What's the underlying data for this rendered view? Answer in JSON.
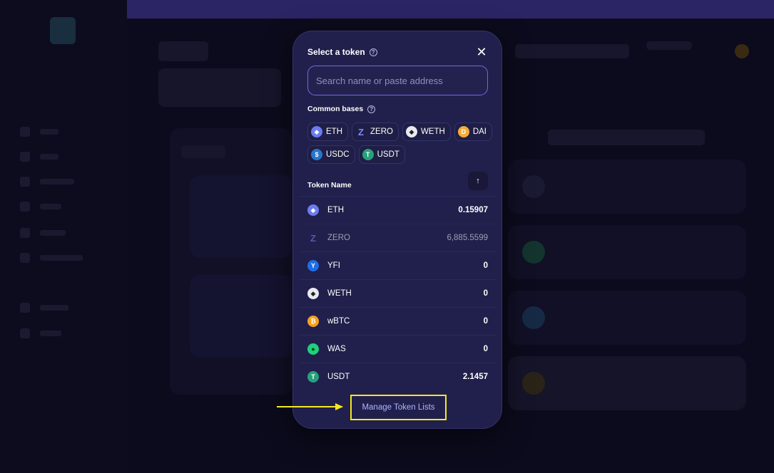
{
  "modal": {
    "title": "Select a token",
    "close_glyph": "✕",
    "help_glyph": "?",
    "search_placeholder": "Search name or paste address",
    "search_value": "",
    "common_bases_label": "Common bases",
    "common_bases": [
      {
        "symbol": "ETH",
        "icon": "eth-icon"
      },
      {
        "symbol": "ZERO",
        "icon": "zero-icon"
      },
      {
        "symbol": "WETH",
        "icon": "weth-icon"
      },
      {
        "symbol": "DAI",
        "icon": "dai-icon"
      },
      {
        "symbol": "USDC",
        "icon": "usdc-icon"
      },
      {
        "symbol": "USDT",
        "icon": "usdt-icon"
      }
    ],
    "token_name_header": "Token Name",
    "sort_glyph": "↑",
    "tokens": [
      {
        "symbol": "ETH",
        "balance": "0.15907",
        "icon": "eth-icon"
      },
      {
        "symbol": "ZERO",
        "balance": "6,885.5599",
        "icon": "zero-icon"
      },
      {
        "symbol": "YFI",
        "balance": "0",
        "icon": "yfi-icon"
      },
      {
        "symbol": "WETH",
        "balance": "0",
        "icon": "weth-icon"
      },
      {
        "symbol": "wBTC",
        "balance": "0",
        "icon": "wbtc-icon"
      },
      {
        "symbol": "WAS",
        "balance": "0",
        "icon": "was-icon"
      },
      {
        "symbol": "USDT",
        "balance": "2.1457",
        "icon": "usdt-icon"
      }
    ],
    "manage_link": "Manage Token Lists"
  },
  "colors": {
    "modal_bg": "#21204c",
    "accent_border": "#6d6be0",
    "highlight": "#f2e824",
    "link": "#b0b4ff"
  }
}
